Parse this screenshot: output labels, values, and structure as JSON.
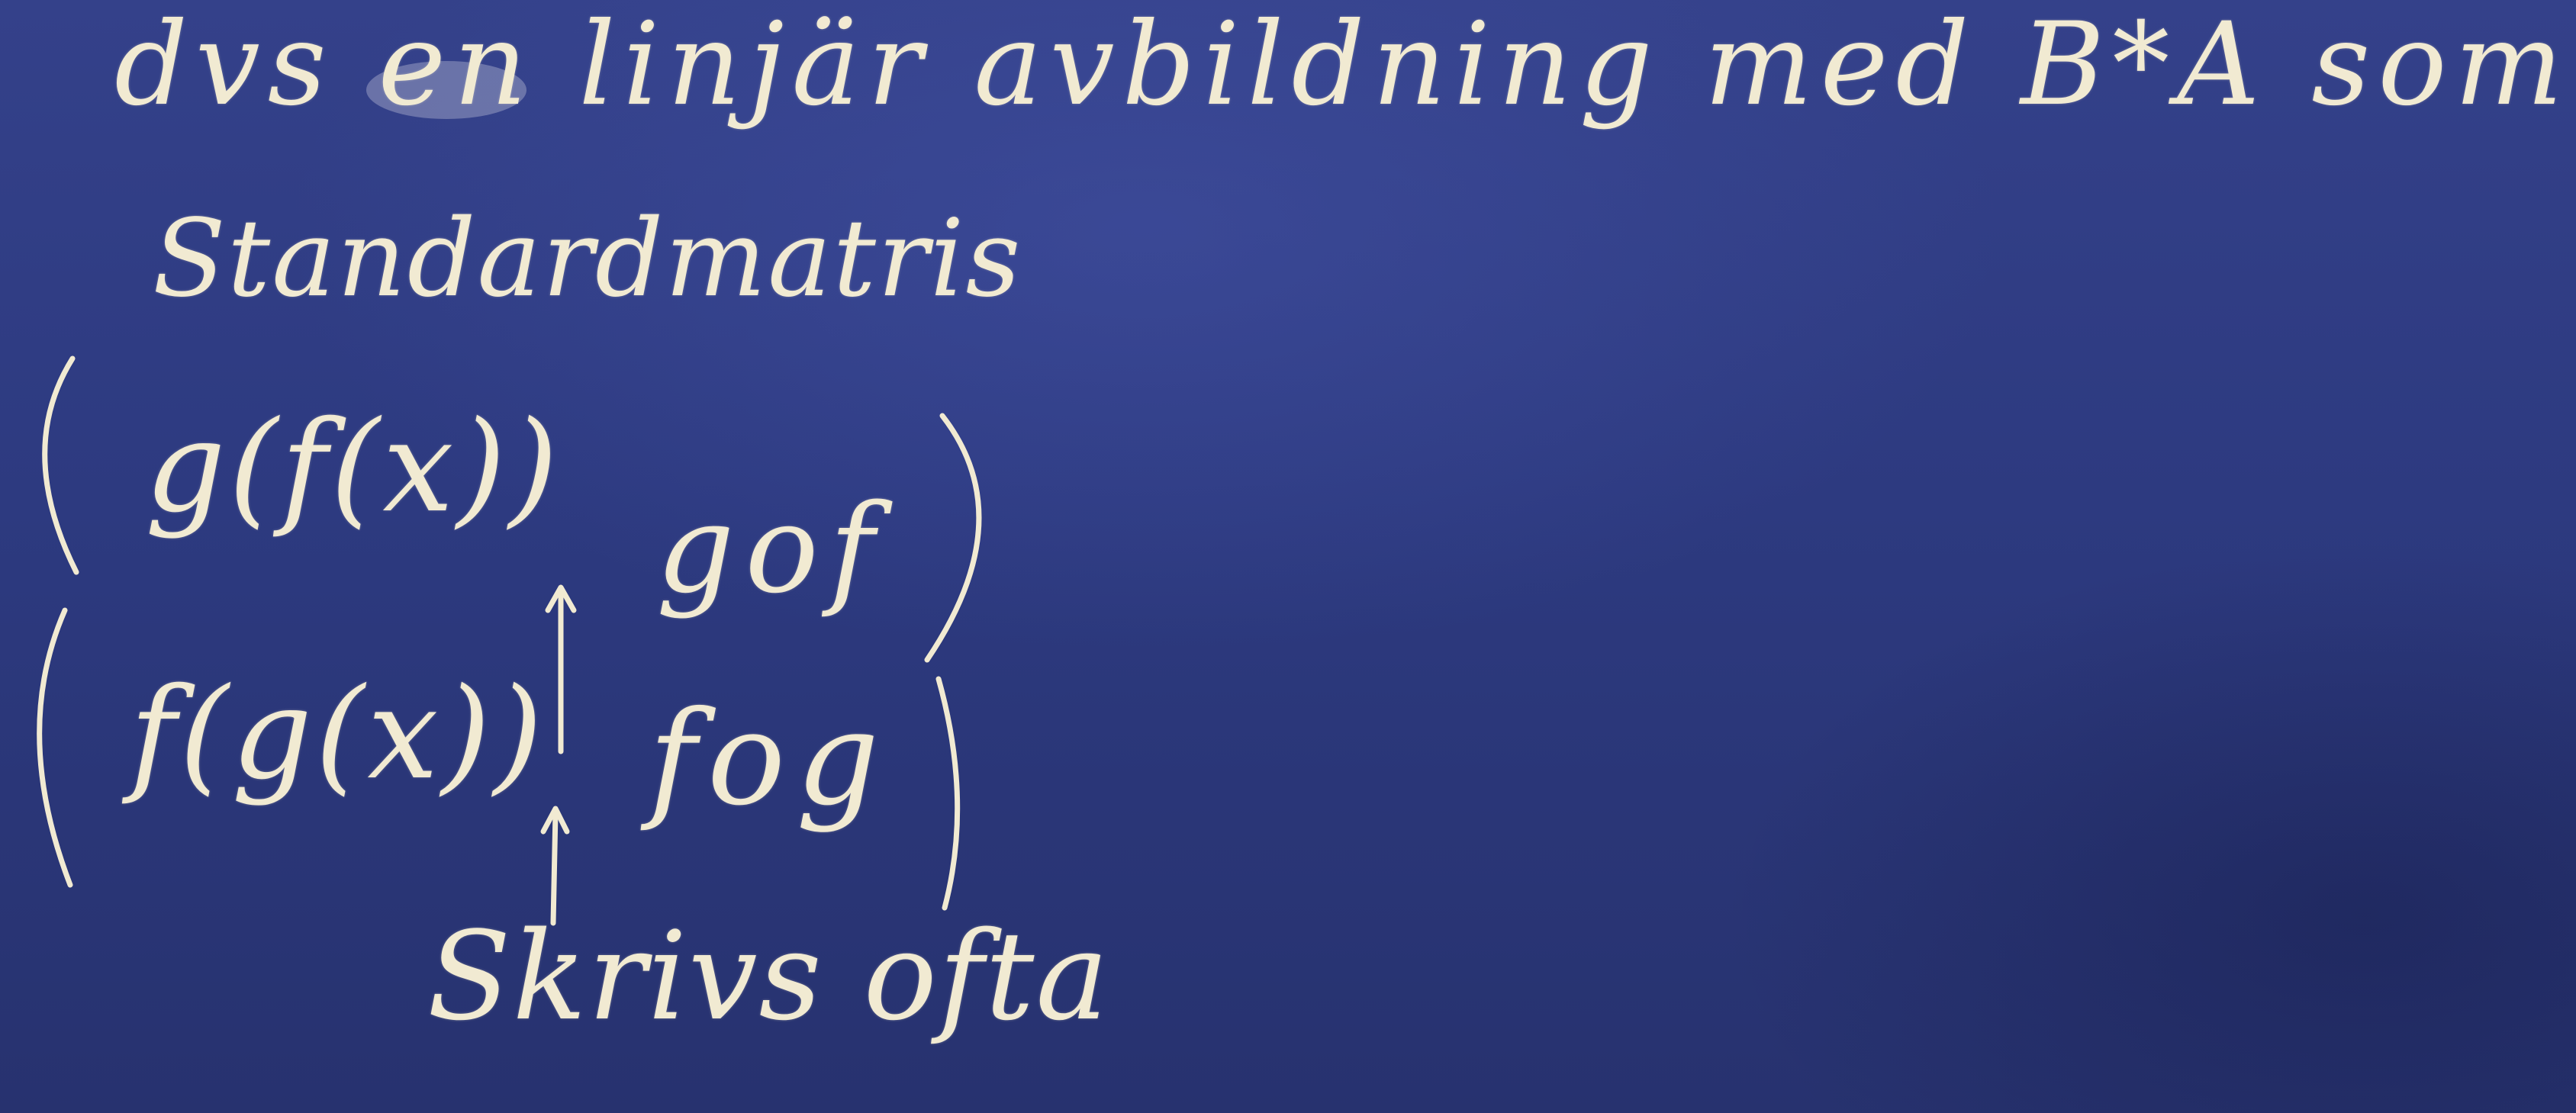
{
  "board": {
    "color": "#2d3a80",
    "chalk_color": "#f1ead2"
  },
  "text": {
    "line1": "dvs en linjär avbildning med B*A som",
    "line2": "Standardmatris",
    "expr_gf": "g(f(x))",
    "expr_fg": "f(g(x))",
    "comp_gof": "gof",
    "comp_fog": "fog",
    "note": "Skrivs ofta"
  }
}
